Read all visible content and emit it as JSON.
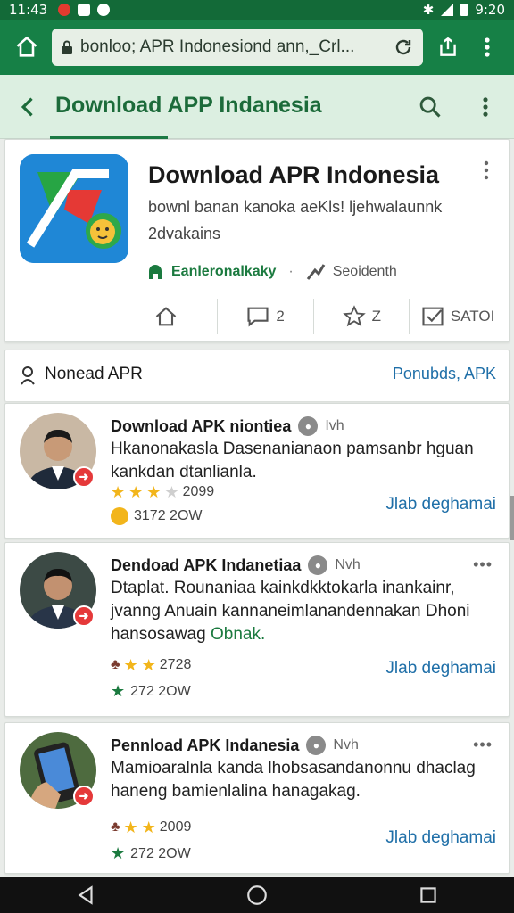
{
  "status_bar": {
    "time": "11:43",
    "right_time": "9:20"
  },
  "browser": {
    "url": "bonloo; APR Indonesiond ann,_Crl..."
  },
  "app_bar": {
    "title": "Download APP Indanesia"
  },
  "app_card": {
    "name": "Download APR Indonesia",
    "description": "bownl banan kanoka aeKls! ljehwalaunnk 2dvakains",
    "meta_left": "Eanleronalkaky",
    "meta_sep": "·",
    "meta_right": "Seoidenth",
    "actions": [
      {
        "label": ""
      },
      {
        "label": "2"
      },
      {
        "label": "Z"
      },
      {
        "label": "SATOI"
      }
    ]
  },
  "section": {
    "label": "Nonead APR",
    "link": "Ponubds, APK"
  },
  "items": [
    {
      "title": "Download APK niontiea",
      "meta": "Ivh",
      "text": "Hkanonakasla Dasenanianaon pamsanbr hguan kankdan dtanlianla.",
      "rating": "2099",
      "count": "3172 2OW",
      "cta": "Jlab deghamai"
    },
    {
      "title": "Dendoad APK Indanetiaa",
      "meta": "Nvh",
      "text": "Dtaplat. Rounaniaa kainkdkktokarla inankainr, jvanng Anuain kannaneimlanandennakan Dhoni hansosawag",
      "text_green": "Obnak.",
      "rating": "2728",
      "count": "272 2OW",
      "cta": "Jlab deghamai"
    },
    {
      "title": "Pennload APK Indanesia",
      "meta": "Nvh",
      "text": "Mamioaralnla kanda lhobsasandanonnu dhaclag haneng bamienlalina hanagakag.",
      "rating": "2009",
      "count": "272 2OW",
      "cta": "Jlab deghamai"
    }
  ],
  "colors": {
    "primary": "#168046",
    "link": "#1f6fa8",
    "star": "#f2b51b"
  }
}
